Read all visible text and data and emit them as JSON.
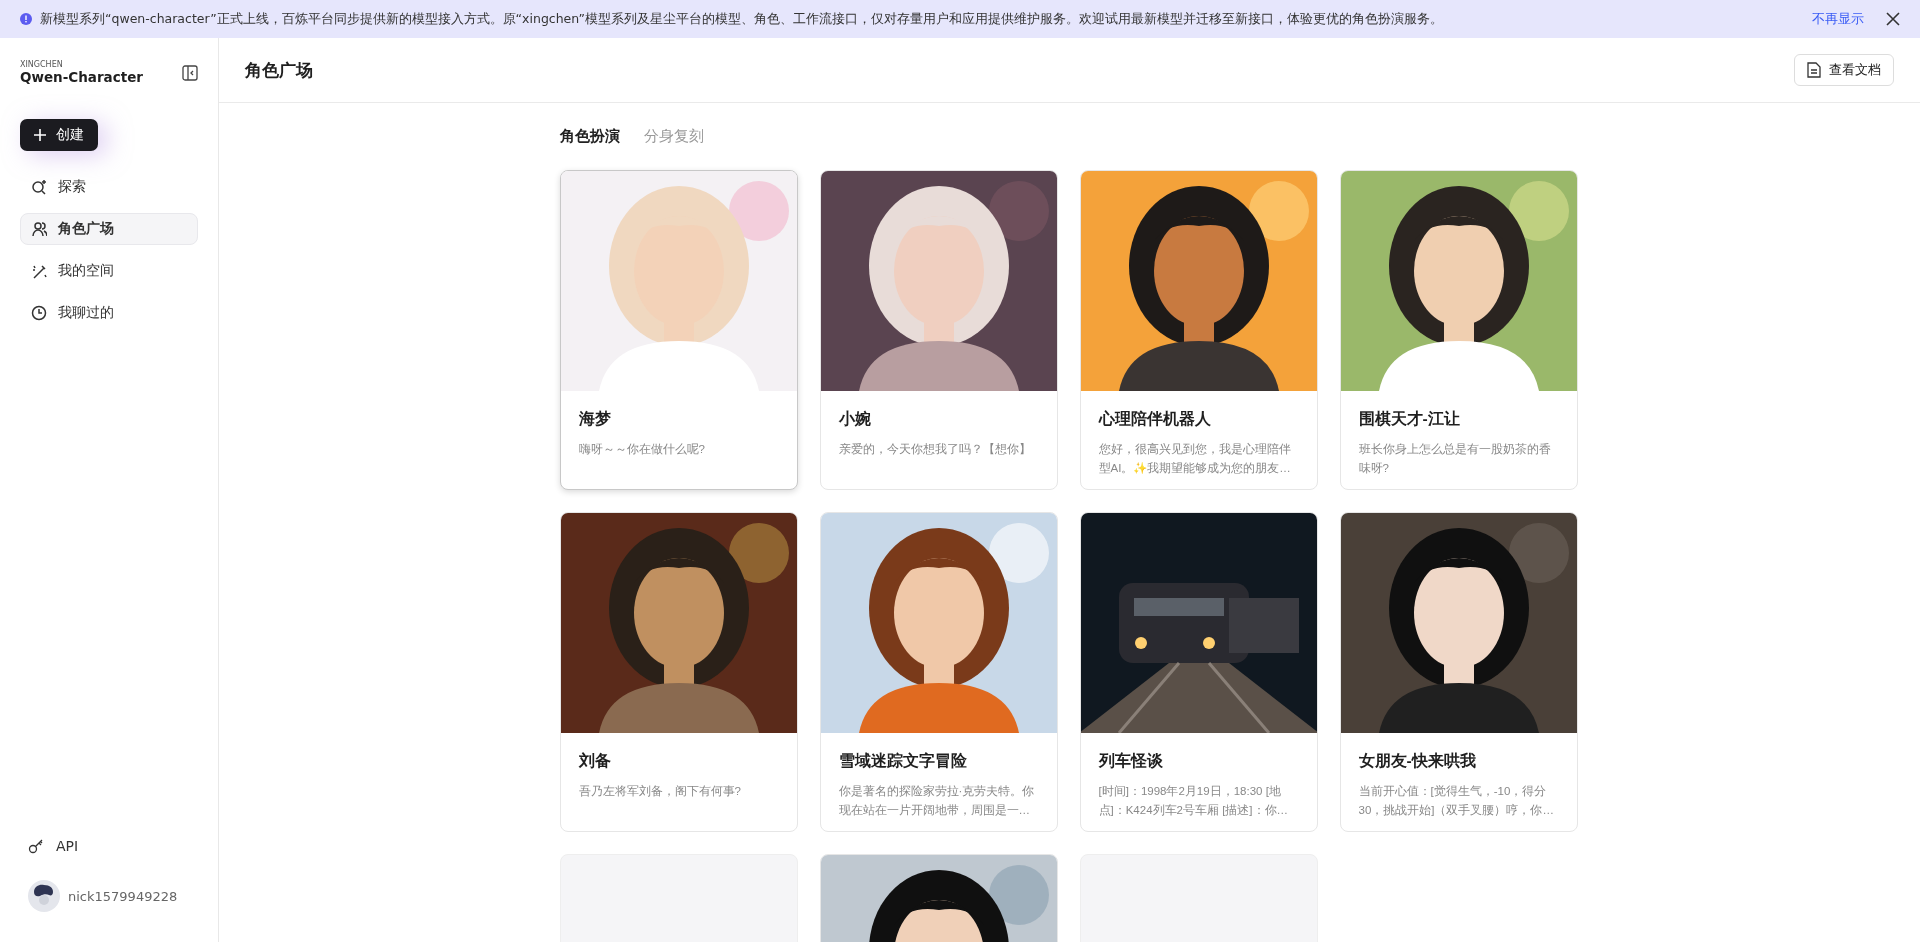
{
  "banner": {
    "text": "新模型系列“qwen-character”正式上线，百炼平台同步提供新的模型接入方式。原“xingchen”模型系列及星尘平台的模型、角色、工作流接口，仅对存量用户和应用提供维护服务。欢迎试用最新模型并迁移至新接口，体验更优的角色扮演服务。",
    "dismiss": "不再显示"
  },
  "sidebar": {
    "brand_small": "XINGCHEN",
    "brand": "Qwen-Character",
    "create_button": "创建",
    "items": [
      {
        "label": "探索",
        "selected": false
      },
      {
        "label": "角色广场",
        "selected": true
      },
      {
        "label": "我的空间",
        "selected": false
      },
      {
        "label": "我聊过的",
        "selected": false
      }
    ],
    "api": "API",
    "user": "nick1579949228"
  },
  "header": {
    "title": "角色广场",
    "docs_button": "查看文档"
  },
  "tabs": [
    {
      "label": "角色扮演",
      "selected": true
    },
    {
      "label": "分身复刻",
      "selected": false
    }
  ],
  "cards": [
    {
      "kind": "character",
      "name": "海梦",
      "description": "嗨呀～～你在做什么呢?",
      "selected": true
    },
    {
      "kind": "character",
      "name": "小婉",
      "description": "亲爱的，今天你想我了吗？【想你】",
      "selected": false
    },
    {
      "kind": "character",
      "name": "心理陪伴机器人",
      "description": "您好，很高兴见到您，我是心理陪伴型AI。✨我期望能够成为您的朋友…",
      "selected": false
    },
    {
      "kind": "character",
      "name": "围棋天才-江让",
      "description": "班长你身上怎么总是有一股奶茶的香味呀?",
      "selected": false
    },
    {
      "kind": "character",
      "name": "刘备",
      "description": "吾乃左将军刘备，阁下有何事?",
      "selected": false
    },
    {
      "kind": "character",
      "name": "雪域迷踪文字冒险",
      "description": "你是著名的探险家劳拉·克劳夫特。你现在站在一片开阔地带，周围是一…",
      "selected": false
    },
    {
      "kind": "character",
      "name": "列车怪谈",
      "description": "[时间]：1998年2月19日，18:30 [地点]：K424列车2号车厢 [描述]：你…",
      "selected": false
    },
    {
      "kind": "character",
      "name": "女朋友-快来哄我",
      "description": "当前开心值：[觉得生气，-10，得分30，挑战开始]（双手叉腰）哼，你…",
      "selected": false
    },
    {
      "kind": "placeholder",
      "selected": false
    },
    {
      "kind": "character",
      "selected": false
    },
    {
      "kind": "placeholder",
      "selected": false
    }
  ]
}
